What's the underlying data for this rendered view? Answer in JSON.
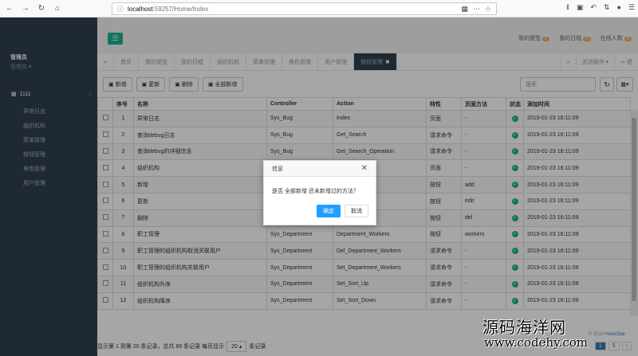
{
  "browser": {
    "url_host": "localhost",
    "url_path": ":59257/Home/Index"
  },
  "sidebar": {
    "user_name": "管理员",
    "user_role": "管理员",
    "menu_head": "1111",
    "items": [
      {
        "label": "异常日志"
      },
      {
        "label": "组织机构"
      },
      {
        "label": "菜单管理"
      },
      {
        "label": "按钮管理"
      },
      {
        "label": "角色管理"
      },
      {
        "label": "用户管理"
      }
    ]
  },
  "topbar": {
    "link1": "我的便签",
    "badge1": "0",
    "link2": "我的日程",
    "badge2": "0",
    "link3": "在线人数",
    "badge3": "0"
  },
  "tabs": [
    {
      "label": "首页"
    },
    {
      "label": "我的便签"
    },
    {
      "label": "我的日程"
    },
    {
      "label": "组织机构"
    },
    {
      "label": "菜单管理"
    },
    {
      "label": "角色管理"
    },
    {
      "label": "用户管理"
    },
    {
      "label": "按钮管理",
      "active": true
    }
  ],
  "tab_close_ops": "关闭操作",
  "tab_logout": "退",
  "toolbar": {
    "add": "新增",
    "update": "更新",
    "delete": "删除",
    "add_all": "全部新增",
    "search_placeholder": "搜索"
  },
  "table": {
    "headers": [
      "序号",
      "名称",
      "Controller",
      "Action",
      "特性",
      "页面方法",
      "状态",
      "添加时间"
    ],
    "rows": [
      [
        "1",
        "异常日志",
        "Sys_Bug",
        "Index",
        "页面",
        "-",
        "2019-01-23 16:11:09"
      ],
      [
        "2",
        "查询debug日志",
        "Sys_Bug",
        "Get_Search",
        "请求命令",
        "-",
        "2019-01-23 16:11:09"
      ],
      [
        "3",
        "查询debug的详细信息",
        "Sys_Bug",
        "Get_Search_Operation",
        "请求命令",
        "-",
        "2019-01-23 16:11:09"
      ],
      [
        "4",
        "组织机构",
        "",
        "",
        "页面",
        "-",
        "2019-01-23 16:11:09"
      ],
      [
        "5",
        "新增",
        "",
        "dd",
        "按钮",
        "add",
        "2019-01-23 16:11:09"
      ],
      [
        "6",
        "更新",
        "",
        "dit",
        "按钮",
        "edit",
        "2019-01-23 16:11:09"
      ],
      [
        "7",
        "删除",
        "",
        "",
        "按钮",
        "del",
        "2019-01-23 16:11:09"
      ],
      [
        "8",
        "职工管理",
        "Sys_Department",
        "Department_Workers",
        "按钮",
        "workers",
        "2019-01-23 16:11:09"
      ],
      [
        "9",
        "职工管理的组织机构取消关联用户",
        "Sys_Department",
        "Del_Department_Workers",
        "请求命令",
        "-",
        "2019-01-23 16:11:09"
      ],
      [
        "10",
        "职工管理的组织机构关联用户",
        "Sys_Department",
        "Set_Department_Workers",
        "请求命令",
        "-",
        "2019-01-23 16:11:09"
      ],
      [
        "11",
        "组织机构升序",
        "Sys_Department",
        "Set_Sort_Up",
        "请求命令",
        "-",
        "2019-01-23 16:11:09"
      ],
      [
        "12",
        "组织机构降序",
        "Sys_Department",
        "Set_Sort_Down",
        "请求命令",
        "-",
        "2019-01-23 16:11:09"
      ]
    ]
  },
  "footer": {
    "summary": "显示第 1 到第 20 条记录，总共 89 条记录 每页显示",
    "page_size": "20",
    "suffix": "条记录",
    "pages": [
      "1",
      "5",
      "›"
    ]
  },
  "copyright": "© 2018",
  "copyright_brand": "HankStar",
  "dialog": {
    "title": "信息",
    "message": "是否 全部新增 还未新增过的方法？",
    "ok": "确定",
    "cancel": "取消"
  },
  "watermark": {
    "line1": "源码海洋网",
    "line2": "www.codehy.com"
  }
}
